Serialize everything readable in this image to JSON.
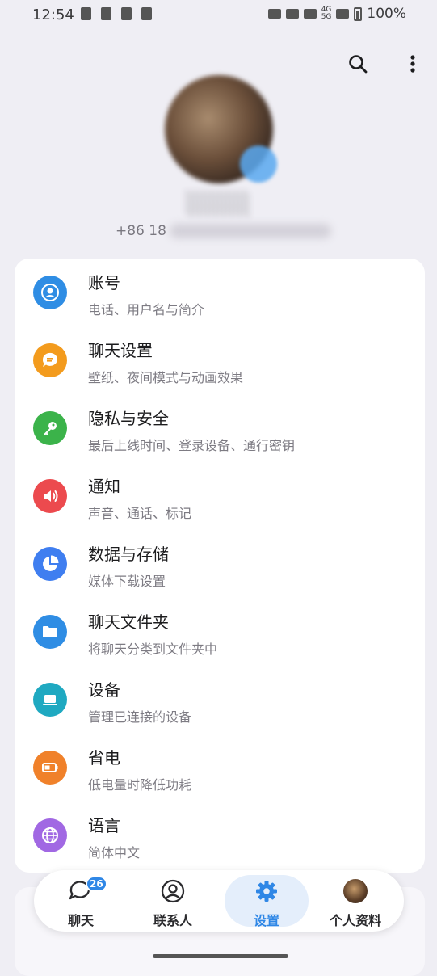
{
  "status_bar": {
    "time": "12:54",
    "battery": "100%",
    "network_top": "4G",
    "network_bottom": "5G"
  },
  "top_actions": {
    "search_icon": "search-icon",
    "more_icon": "more-vertical-icon"
  },
  "profile": {
    "phone_prefix": "+86 18"
  },
  "settings": {
    "items": [
      {
        "title": "账号",
        "subtitle": "电话、用户名与简介",
        "icon": "person-icon",
        "color": "#2f8de4"
      },
      {
        "title": "聊天设置",
        "subtitle": "壁纸、夜间模式与动画效果",
        "icon": "chat-bubble-icon",
        "color": "#f39b1d"
      },
      {
        "title": "隐私与安全",
        "subtitle": "最后上线时间、登录设备、通行密钥",
        "icon": "key-icon",
        "color": "#3bb34a"
      },
      {
        "title": "通知",
        "subtitle": "声音、通话、标记",
        "icon": "speaker-icon",
        "color": "#ec4a4e"
      },
      {
        "title": "数据与存储",
        "subtitle": "媒体下载设置",
        "icon": "pie-chart-icon",
        "color": "#3f7ef0"
      },
      {
        "title": "聊天文件夹",
        "subtitle": "将聊天分类到文件夹中",
        "icon": "folder-icon",
        "color": "#2f8de4"
      },
      {
        "title": "设备",
        "subtitle": "管理已连接的设备",
        "icon": "laptop-icon",
        "color": "#1fa9c1"
      },
      {
        "title": "省电",
        "subtitle": "低电量时降低功耗",
        "icon": "battery-icon",
        "color": "#f0812a"
      },
      {
        "title": "语言",
        "subtitle": "简体中文",
        "icon": "globe-icon",
        "color": "#a168e3"
      }
    ]
  },
  "bottom_nav": {
    "chats": "聊天",
    "chats_badge": "26",
    "contacts": "联系人",
    "settings": "设置",
    "profile": "个人资料",
    "active": "settings"
  }
}
